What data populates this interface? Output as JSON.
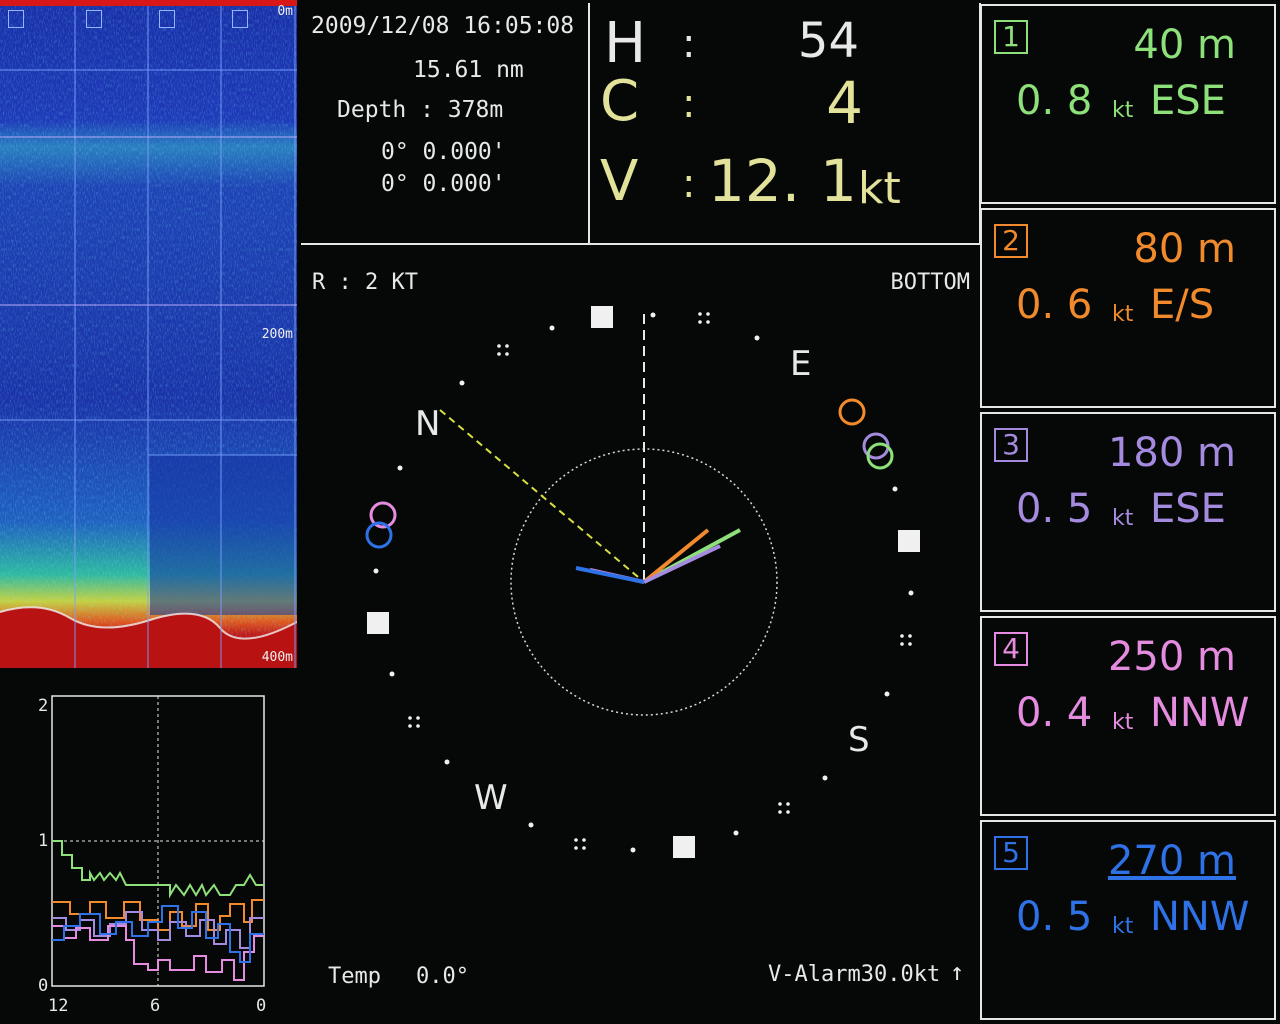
{
  "echogram": {
    "depth_labels": [
      "0m",
      "200m",
      "400m"
    ]
  },
  "info": {
    "datetime": "2009/12/08 16:05:08",
    "distance": "15.61 nm",
    "depth": "Depth : 378m",
    "lat": "0° 0.000'",
    "lon": "0° 0.000'"
  },
  "hcv": {
    "h_label": "H",
    "h_colon": ":",
    "h_value": "54",
    "c_label": "C",
    "c_colon": ":",
    "c_value": "4",
    "v_label": "V",
    "v_colon": ":",
    "v_value": "12.",
    "v_value2": "1",
    "v_unit": "kt"
  },
  "compass": {
    "range_label": "R : 2 KT",
    "mode_label": "BOTTOM",
    "north": "N",
    "east": "E",
    "south": "S",
    "west": "W",
    "temp_label": "Temp",
    "temp_value": "0.0°",
    "alarm_label": "V-Alarm30.0kt",
    "alarm_arrow": "↑"
  },
  "layers": [
    {
      "num": "1",
      "depth": "40 m",
      "speed": "0. 8",
      "unit": "kt",
      "dir": "ESE",
      "color": "#8ee07a"
    },
    {
      "num": "2",
      "depth": "80 m",
      "speed": "0. 6",
      "unit": "kt",
      "dir": "E/S",
      "color": "#f08a2c"
    },
    {
      "num": "3",
      "depth": "180 m",
      "speed": "0. 5",
      "unit": "kt",
      "dir": "ESE",
      "color": "#a58be0"
    },
    {
      "num": "4",
      "depth": "250 m",
      "speed": "0. 4",
      "unit": "kt",
      "dir": "NNW",
      "color": "#e58ce0"
    },
    {
      "num": "5",
      "depth": "270 m",
      "speed": "0. 5",
      "unit": "kt",
      "dir": "NNW",
      "color": "#2f72e8"
    }
  ],
  "history": {
    "y_labels": [
      "2",
      "1",
      "0"
    ],
    "x_labels": [
      "12",
      "6",
      "0"
    ]
  },
  "colors": {
    "hcv_yellow": "#e2e29a",
    "layer1": "#8ee07a",
    "layer2": "#f08a2c",
    "layer3": "#a58be0",
    "layer4": "#e58ce0",
    "layer5": "#2f72e8"
  }
}
